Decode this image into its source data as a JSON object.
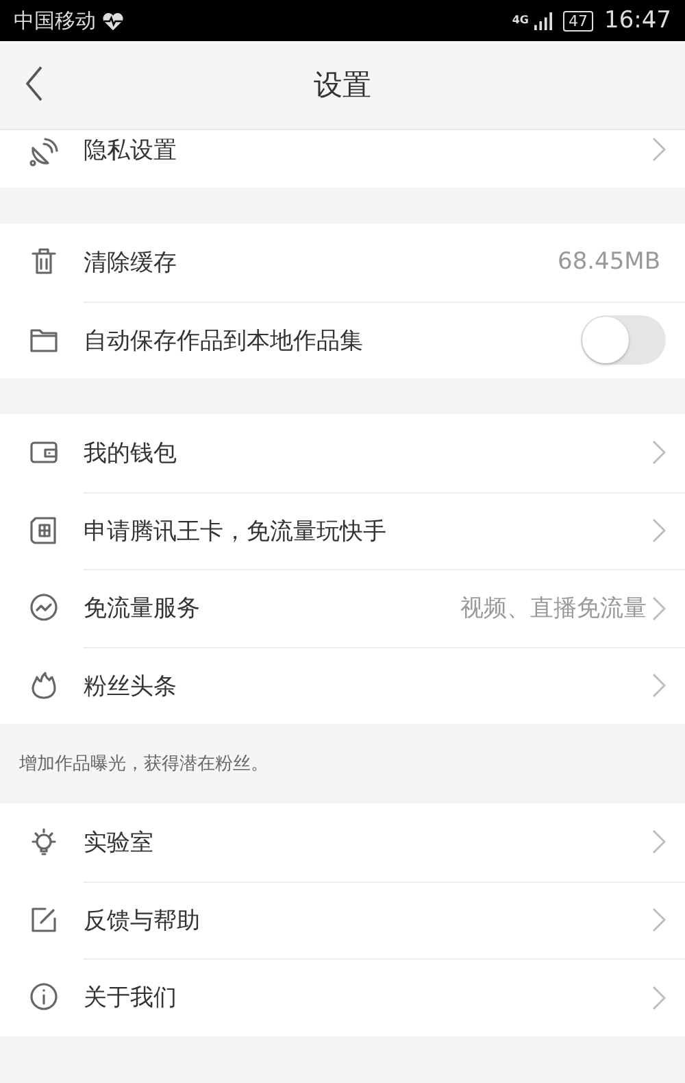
{
  "status_bar": {
    "carrier": "中国移动",
    "network": "4G",
    "battery": "47",
    "time": "16:47"
  },
  "header": {
    "title": "设置"
  },
  "sections": [
    {
      "cut_top": true,
      "items": [
        {
          "kind": "link",
          "label": "隐私设置"
        }
      ]
    },
    {
      "items": [
        {
          "kind": "value",
          "label": "清除缓存",
          "value": "68.45MB"
        },
        {
          "kind": "toggle",
          "label": "自动保存作品到本地作品集",
          "on": false
        }
      ]
    },
    {
      "items": [
        {
          "kind": "link",
          "label": "我的钱包"
        },
        {
          "kind": "link",
          "label": "申请腾讯王卡，免流量玩快手"
        },
        {
          "kind": "link",
          "label": "免流量服务",
          "value": "视频、直播免流量"
        },
        {
          "kind": "link",
          "label": "粉丝头条"
        }
      ],
      "note": "增加作品曝光，获得潜在粉丝。"
    },
    {
      "items": [
        {
          "kind": "link",
          "label": "实验室"
        },
        {
          "kind": "link",
          "label": "反馈与帮助"
        },
        {
          "kind": "link",
          "label": "关于我们"
        }
      ]
    }
  ]
}
